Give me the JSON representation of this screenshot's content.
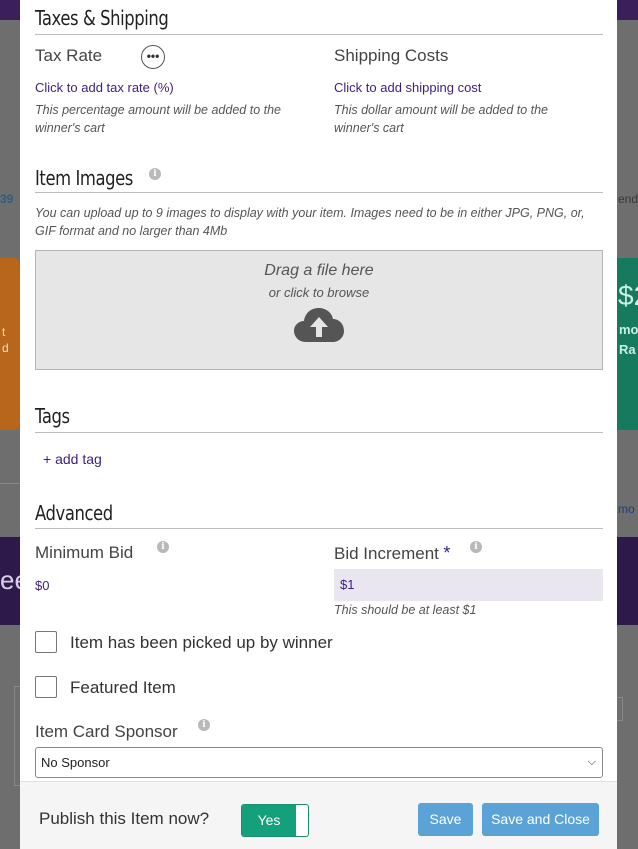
{
  "background": {
    "left_tab_fragment": "39",
    "right_tab_fragment": "end",
    "right_card_amount": "$2",
    "right_card_line1": "mo",
    "right_card_line2": "Ra",
    "right_link_fragment": "mo",
    "left_band_fragment": "ee",
    "left_card_line1": "t",
    "left_card_line2": "d"
  },
  "taxes_shipping": {
    "title": "Taxes & Shipping",
    "tax": {
      "label": "Tax Rate",
      "more_icon": "•••",
      "link": "Click to add tax rate (%)",
      "help": "This percentage amount will be added to the winner's cart"
    },
    "shipping": {
      "label": "Shipping Costs",
      "link": "Click to add shipping cost",
      "help": "This dollar amount will be added to the winner's cart"
    }
  },
  "item_images": {
    "title": "Item Images",
    "info_icon": "i",
    "help": "You can upload up to 9 images to display with your item. Images need to be in either JPG, PNG, or, GIF format and no larger than 4Mb",
    "dropzone_main": "Drag a file here",
    "dropzone_sub": "or click to browse",
    "upload_icon": "cloud-upload-icon"
  },
  "tags": {
    "title": "Tags",
    "add_tag": "+ add tag"
  },
  "advanced": {
    "title": "Advanced",
    "minimum_bid": {
      "label": "Minimum Bid",
      "value": "$0"
    },
    "bid_increment": {
      "label": "Bid Increment",
      "required_mark": "*",
      "value": "$1",
      "help": "This should be at least $1"
    },
    "picked_up_label": "Item has been picked up by winner",
    "featured_label": "Featured Item",
    "sponsor": {
      "label": "Item Card Sponsor",
      "selected": "No Sponsor"
    }
  },
  "footer": {
    "publish_label": "Publish this Item now?",
    "toggle_label": "Yes",
    "save_label": "Save",
    "save_close_label": "Save and Close"
  },
  "colors": {
    "accent_purple": "#3d1f7a",
    "toggle_green": "#14a07a",
    "button_blue": "#5ba3d6"
  }
}
